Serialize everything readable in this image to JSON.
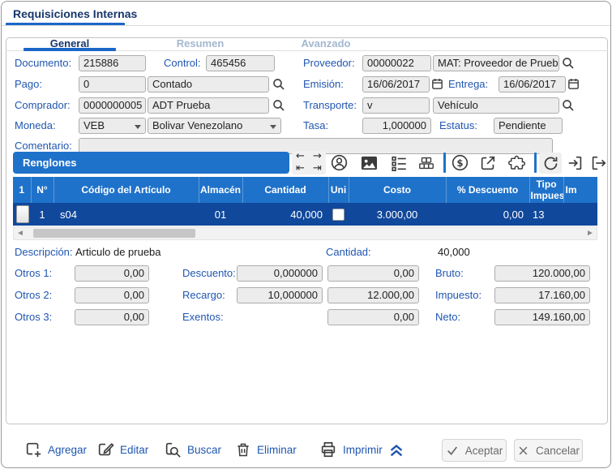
{
  "window": {
    "title": "Requisiciones Internas"
  },
  "tabs": [
    {
      "label": "General",
      "active": true
    },
    {
      "label": "Resumen",
      "active": false
    },
    {
      "label": "Avanzado",
      "active": false
    }
  ],
  "form": {
    "documento": {
      "label": "Documento:",
      "value": "215886"
    },
    "control": {
      "label": "Control:",
      "value": "465456"
    },
    "proveedor": {
      "label": "Proveedor:",
      "code": "00000022",
      "name": "MAT: Proveedor de Prueba"
    },
    "pago": {
      "label": "Pago:",
      "code": "0",
      "name": "Contado"
    },
    "emision": {
      "label": "Emisión:",
      "value": "16/06/2017"
    },
    "entrega": {
      "label": "Entrega:",
      "value": "16/06/2017"
    },
    "comprador": {
      "label": "Comprador:",
      "code": "0000000005",
      "name": "ADT Prueba"
    },
    "transporte": {
      "label": "Transporte:",
      "code": "v",
      "name": "Vehículo"
    },
    "moneda": {
      "label": "Moneda:",
      "code": "VEB",
      "name": "Bolivar Venezolano"
    },
    "tasa": {
      "label": "Tasa:",
      "value": "1,000000"
    },
    "estatus": {
      "label": "Estatus:",
      "value": "Pendiente"
    },
    "comentario": {
      "label": "Comentario:",
      "value": ""
    }
  },
  "renglones": {
    "title": "Renglones",
    "toolbar_icons": [
      "nav-first-prev-next-last",
      "user",
      "image",
      "list",
      "stock-boxes",
      "currency",
      "open-external",
      "plugin",
      "refresh",
      "import",
      "export"
    ],
    "table": {
      "columns": [
        "1",
        "N°",
        "Código del Artículo",
        "Almacén",
        "Cantidad",
        "Uni",
        "Costo",
        "% Descuento",
        "Tipo Impuesto",
        "Im"
      ],
      "rows": [
        {
          "n": "1",
          "codigo": "s04",
          "almacen": "01",
          "cantidad": "40,000",
          "costo": "3.000,00",
          "descuento": "0,00",
          "tipo": "13"
        }
      ]
    }
  },
  "detail": {
    "descripcion": {
      "label": "Descripción:",
      "value": "Articulo de prueba"
    },
    "cantidad": {
      "label": "Cantidad:",
      "value": "40,000"
    },
    "otros1": {
      "label": "Otros 1:",
      "value": "0,00"
    },
    "otros2": {
      "label": "Otros 2:",
      "value": "0,00"
    },
    "otros3": {
      "label": "Otros 3:",
      "value": "0,00"
    },
    "descuento": {
      "label": "Descuento:",
      "pct": "0,000000",
      "amount": "0,00"
    },
    "recargo": {
      "label": "Recargo:",
      "pct": "10,000000",
      "amount": "12.000,00"
    },
    "exentos": {
      "label": "Exentos:",
      "value": "0,00"
    },
    "bruto": {
      "label": "Bruto:",
      "value": "120.000,00"
    },
    "impuesto": {
      "label": "Impuesto:",
      "value": "17.160,00"
    },
    "neto": {
      "label": "Neto:",
      "value": "149.160,00"
    }
  },
  "actions": {
    "agregar": "Agregar",
    "editar": "Editar",
    "buscar": "Buscar",
    "eliminar": "Eliminar",
    "imprimir": "Imprimir",
    "aceptar": "Aceptar",
    "cancelar": "Cancelar"
  },
  "colors": {
    "accent_blue": "#1f72ca",
    "selected_row_blue": "#10489c",
    "label_blue": "#2056b0",
    "title_blue": "#17366d",
    "inactive_tab": "#a3b8cf",
    "input_bg": "#ececec"
  }
}
